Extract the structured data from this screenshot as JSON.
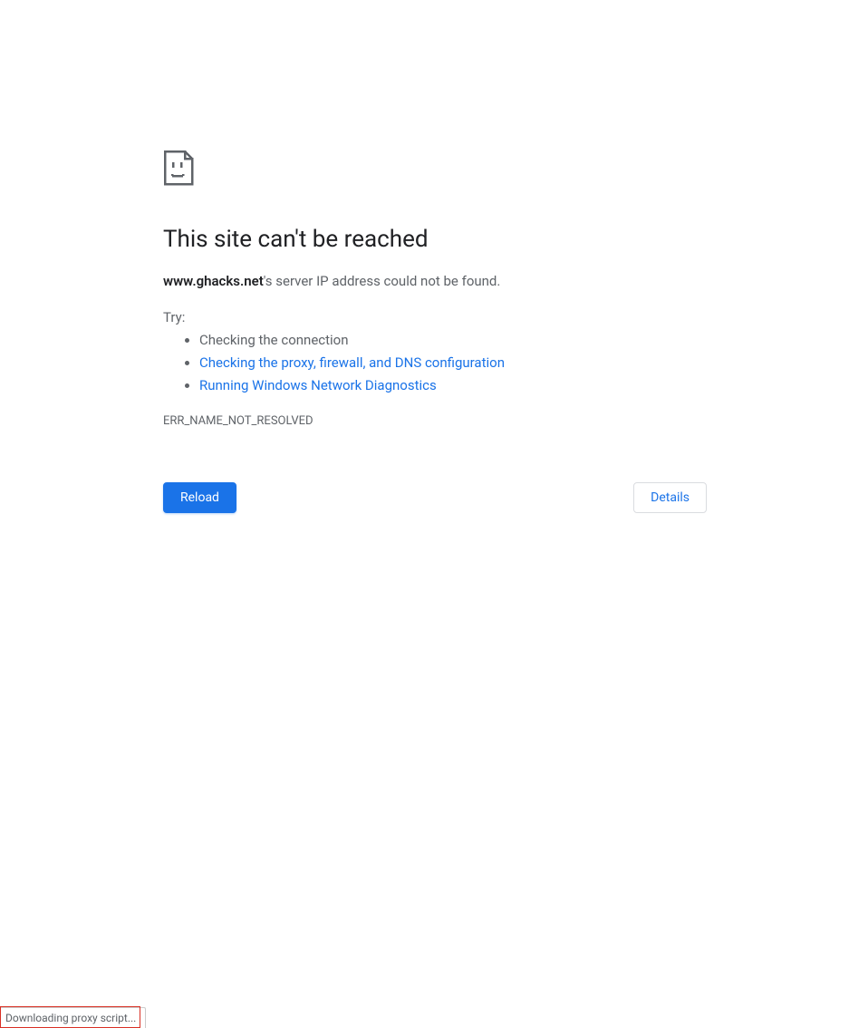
{
  "error": {
    "title": "This site can't be reached",
    "host_strong": "www.ghacks.net",
    "message_suffix": "'s server IP address could not be found.",
    "try_label": "Try:",
    "suggestions": {
      "plain": "Checking the connection",
      "link1": "Checking the proxy, firewall, and DNS configuration",
      "link2": "Running Windows Network Diagnostics"
    },
    "code": "ERR_NAME_NOT_RESOLVED"
  },
  "buttons": {
    "reload": "Reload",
    "details": "Details"
  },
  "status_bar": {
    "text": "Downloading proxy script..."
  }
}
